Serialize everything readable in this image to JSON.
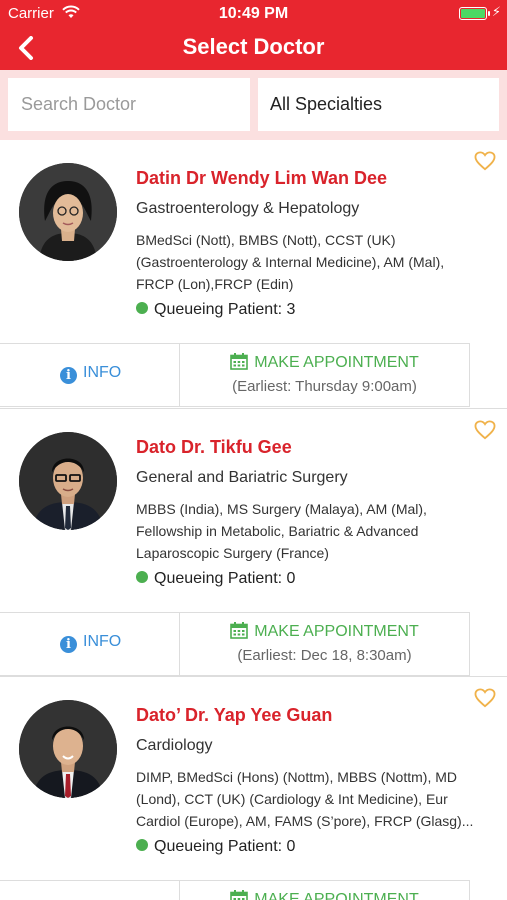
{
  "status_bar": {
    "carrier": "Carrier",
    "time": "10:49 PM"
  },
  "header": {
    "title": "Select Doctor"
  },
  "filters": {
    "search_placeholder": "Search Doctor",
    "specialty_selected": "All Specialties"
  },
  "actions": {
    "info_label": "INFO",
    "appointment_label": "MAKE APPOINTMENT"
  },
  "colors": {
    "brand_red": "#e8262f",
    "name_red": "#d9232b",
    "accent_green": "#4caf50",
    "info_blue": "#3a8fd9",
    "favorite_gold": "#f0b24a"
  },
  "doctors": [
    {
      "name": "Datin Dr Wendy Lim Wan Dee",
      "specialty": "Gastroenterology & Hepatology",
      "qualifications": "BMedSci (Nott), BMBS (Nott), CCST (UK) (Gastroenterology & Internal Medicine), AM (Mal), FRCP (Lon),FRCP (Edin)",
      "queue": "Queueing Patient: 3",
      "earliest": "(Earliest: Thursday 9:00am)"
    },
    {
      "name": "Dato Dr. Tikfu Gee",
      "specialty": "General and Bariatric Surgery",
      "qualifications": "MBBS (India), MS Surgery (Malaya), AM (Mal), Fellowship in Metabolic, Bariatric & Advanced Laparoscopic Surgery (France)",
      "queue": "Queueing Patient: 0",
      "earliest": "(Earliest: Dec 18, 8:30am)"
    },
    {
      "name": "Dato’ Dr. Yap Yee Guan",
      "specialty": "Cardiology",
      "qualifications": "DIMP, BMedSci (Hons) (Nottm), MBBS (Nottm), MD (Lond), CCT (UK) (Cardiology & Int Medicine), Eur Cardiol (Europe), AM, FAMS (S’pore), FRCP (Glasg)...",
      "queue": "Queueing Patient: 0",
      "earliest": ""
    }
  ]
}
